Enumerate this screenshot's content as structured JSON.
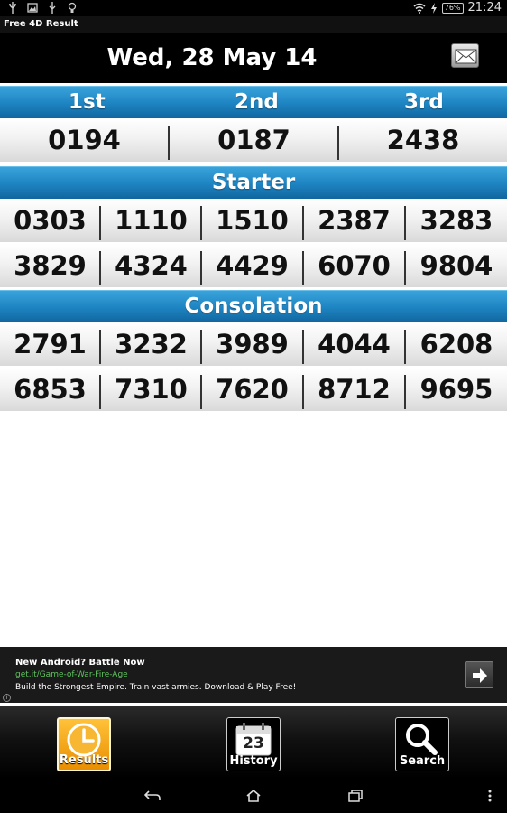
{
  "status_bar": {
    "battery": "76%",
    "time": "21:24"
  },
  "app_title": "Free 4D Result",
  "header": {
    "date": "Wed, 28 May 14"
  },
  "top_prizes": {
    "labels": [
      "1st",
      "2nd",
      "3rd"
    ],
    "values": [
      "0194",
      "0187",
      "2438"
    ]
  },
  "starter": {
    "title": "Starter",
    "rows": [
      [
        "0303",
        "1110",
        "1510",
        "2387",
        "3283"
      ],
      [
        "3829",
        "4324",
        "4429",
        "6070",
        "9804"
      ]
    ]
  },
  "consolation": {
    "title": "Consolation",
    "rows": [
      [
        "2791",
        "3232",
        "3989",
        "4044",
        "6208"
      ],
      [
        "6853",
        "7310",
        "7620",
        "8712",
        "9695"
      ]
    ]
  },
  "ad": {
    "title": "New Android? Battle Now",
    "url": "get.it/Game-of-War-Fire-Age",
    "description": "Build the Strongest Empire. Train vast armies. Download & Play Free!"
  },
  "tabs": [
    {
      "label": "Results",
      "icon": "clock-icon",
      "active": true
    },
    {
      "label": "History",
      "icon": "calendar-icon",
      "day": "23",
      "active": false
    },
    {
      "label": "Search",
      "icon": "magnifier-icon",
      "active": false
    }
  ],
  "colors": {
    "accent_blue": "#1f86c4",
    "active_tab": "#f5a623"
  }
}
